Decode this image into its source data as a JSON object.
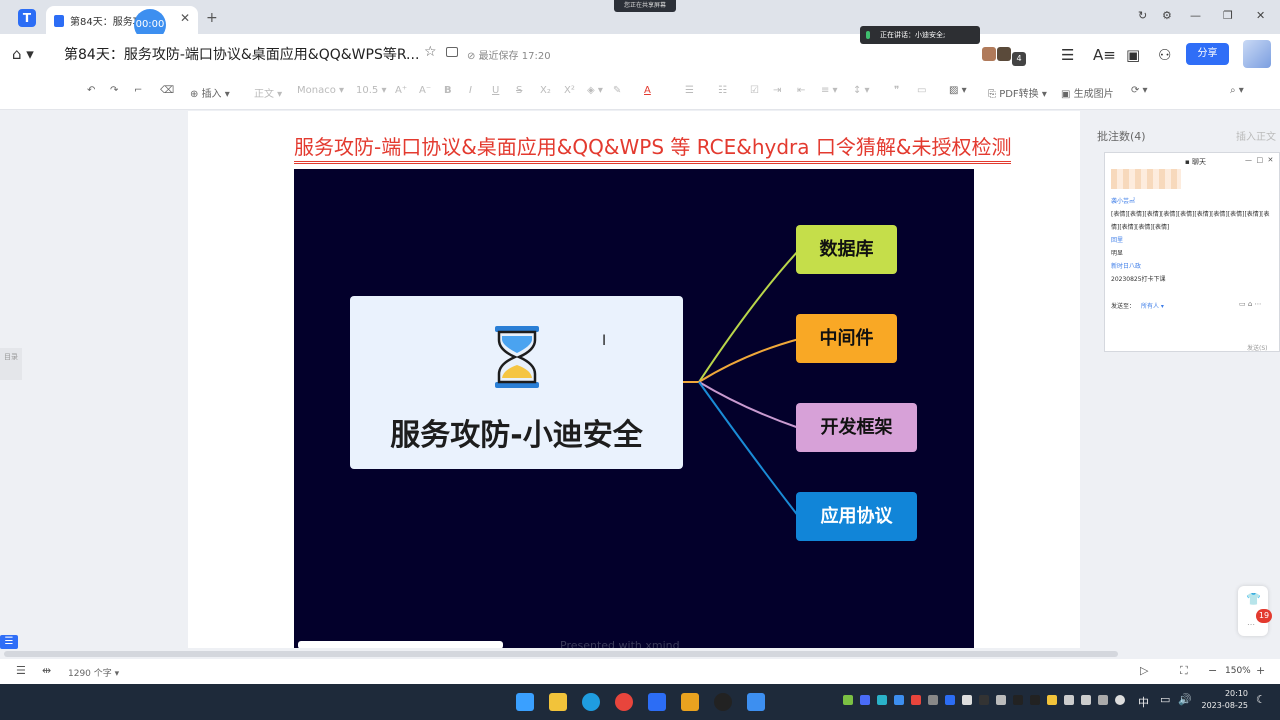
{
  "browser": {
    "tab_title": "第84天：服务攻...",
    "timer": "00:00",
    "share_banner": "您正在共享屏幕",
    "new_tab": "+"
  },
  "docbar": {
    "title": "第84天：服务攻防-端口协议&桌面应用&QQ&WPS等R...",
    "saved": "最近保存 17:20",
    "speaking": "正在讲话：小迪安全;",
    "avatar_count": "4",
    "share_label": "分享"
  },
  "toolbar": {
    "insert": "插入",
    "style": "正文",
    "font": "Monaco",
    "size": "10.5",
    "pdf": "PDF转换",
    "gen_image": "生成图片"
  },
  "document": {
    "heading": "服务攻防-端口协议&桌面应用&QQ&WPS 等 RCE&hydra 口令猜解&未授权检测",
    "mindmap": {
      "center": "服务攻防-小迪安全",
      "nodes": [
        "数据库",
        "中间件",
        "开发框架",
        "应用协议"
      ],
      "node_colors": [
        "#c5de4a",
        "#f9a825",
        "#d7a1d8",
        "#1185d8"
      ],
      "line_colors": [
        "#b9d54a",
        "#f0a83a",
        "#c99ad0",
        "#1a8bd6"
      ],
      "presented": "Presented with xmind"
    },
    "side_catalog": "目录"
  },
  "comments": {
    "header": "批注数(4)",
    "insert_text": "插入正文",
    "chat": {
      "title": "聊天",
      "lines": [
        {
          "text": "袭小芸㎡",
          "color": "#3d7de8"
        },
        {
          "text": "[表情][表情][表情][表情][表情][表情][表情][表情][表情][表",
          "color": "#333"
        },
        {
          "text": "情][表情][表情][表情]",
          "color": "#333"
        },
        {
          "text": "回里",
          "color": "#3d7de8"
        },
        {
          "text": "明显",
          "color": "#333"
        },
        {
          "text": "新时日八政",
          "color": "#3d7de8"
        },
        {
          "text": "20230825打卡下课",
          "color": "#333"
        }
      ],
      "send_to": "发送至：",
      "recipient": "所有人 ▾",
      "send": "发送(S)"
    },
    "badge": "19"
  },
  "statusbar": {
    "wordcount": "1290 个字 ▾",
    "zoom": "150%"
  },
  "taskbar": {
    "time": "20:10",
    "date": "2023-08-25",
    "ime": "中"
  }
}
